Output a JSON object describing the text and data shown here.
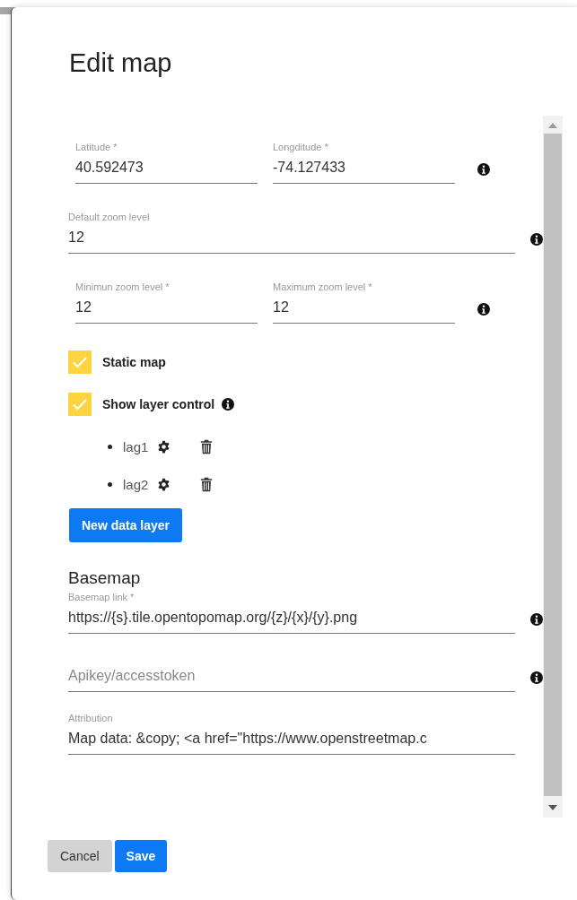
{
  "title": "Edit map",
  "position_rows": [
    {
      "fields": [
        {
          "label": "Latitude *",
          "value": "40.592473"
        },
        {
          "label": "Longditude *",
          "value": "-74.127433"
        }
      ]
    },
    {
      "fields": [
        {
          "label": "Default zoom level",
          "value": "12"
        }
      ]
    },
    {
      "fields": [
        {
          "label": "Minimun zoom level *",
          "value": "12"
        },
        {
          "label": "Maximum zoom level *",
          "value": "12"
        }
      ]
    }
  ],
  "checkboxes": [
    {
      "label": "Static map",
      "checked": true,
      "info": false
    },
    {
      "label": "Show layer control",
      "checked": true,
      "info": true
    }
  ],
  "layers": [
    {
      "name": "lag1"
    },
    {
      "name": "lag2"
    }
  ],
  "new_layer_button": "New data layer",
  "basemap": {
    "heading": "Basemap",
    "fields": [
      {
        "label": "Basemap link *",
        "value": "https://{s}.tile.opentopomap.org/{z}/{x}/{y}.png",
        "info": true
      },
      {
        "placeholder": "Apikey/accesstoken",
        "info": true
      },
      {
        "label": "Attribution",
        "value": "Map data: &copy; <a href=\"https://www.openstreetmap.c",
        "info": false
      }
    ]
  },
  "buttons": [
    {
      "label": "Cancel",
      "kind": "secondary"
    },
    {
      "label": "Save",
      "kind": "primary"
    }
  ]
}
